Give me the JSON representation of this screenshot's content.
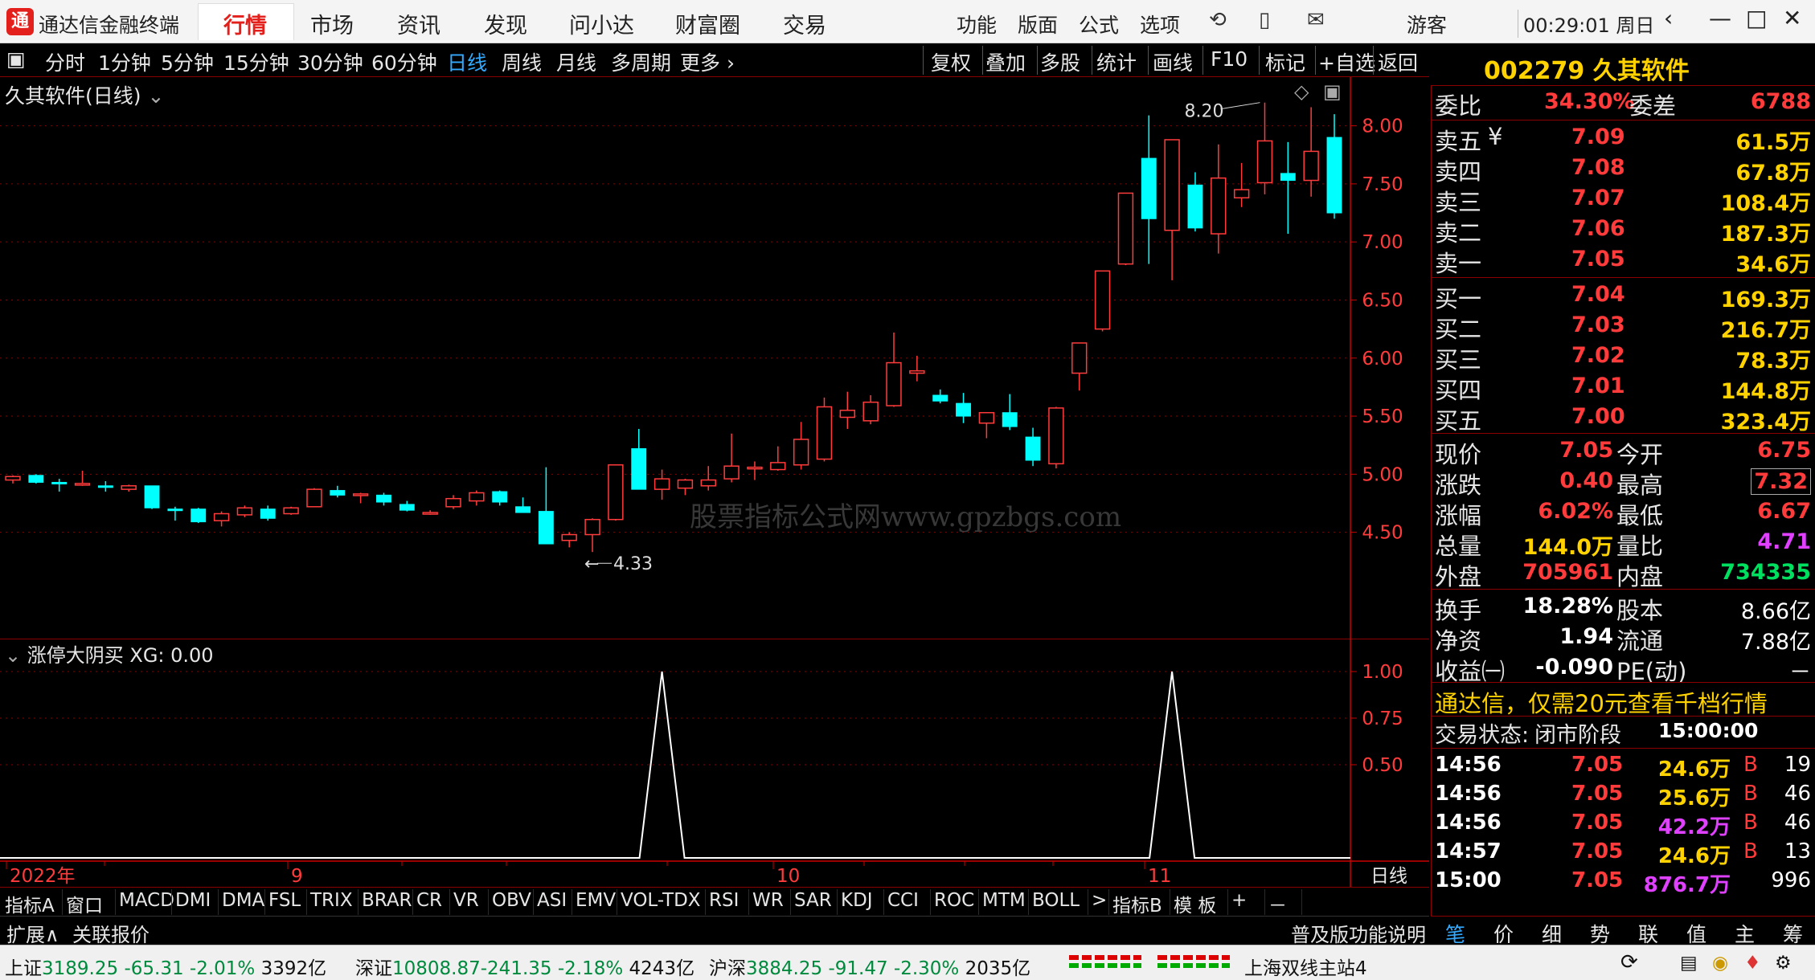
{
  "app": {
    "title": "通达信金融终端",
    "logo": "通"
  },
  "menu": [
    {
      "label": "行情",
      "active": true
    },
    {
      "label": "市场"
    },
    {
      "label": "资讯"
    },
    {
      "label": "发现"
    },
    {
      "label": "问小达"
    },
    {
      "label": "财富圈"
    },
    {
      "label": "交易"
    }
  ],
  "rmenu": [
    "功能",
    "版面",
    "公式",
    "选项"
  ],
  "user": "游客",
  "clock": "00:29:01 周日",
  "periods": [
    "分时",
    "1分钟",
    "5分钟",
    "15分钟",
    "30分钟",
    "60分钟",
    "日线",
    "周线",
    "月线",
    "多周期",
    "更多"
  ],
  "period_selected": "日线",
  "toolbar": [
    "复权",
    "叠加",
    "多股",
    "统计",
    "画线",
    "F10",
    "标记",
    "+自选",
    "返回"
  ],
  "chart": {
    "title": "久其软件(日线)",
    "max_label": "8.20",
    "min_label": "4.33",
    "watermark": "股票指标公式网www.gpzbgs.com",
    "y_ticks": [
      "8.00",
      "7.50",
      "7.00",
      "6.50",
      "6.00",
      "5.50",
      "5.00",
      "4.50"
    ],
    "sub_title": "涨停大阴买 XG: 0.00",
    "sub_ticks": [
      "1.00",
      "0.75",
      "0.50"
    ],
    "x_labels": [
      "2022年",
      "9",
      "10",
      "11"
    ],
    "period_label": "日线"
  },
  "chart_data": {
    "type": "candlestick",
    "title": "久其软件(日线)",
    "ylim": [
      4.2,
      8.35
    ],
    "candles": [
      {
        "o": 4.95,
        "h": 4.99,
        "l": 4.92,
        "c": 4.98
      },
      {
        "o": 4.99,
        "h": 5.0,
        "l": 4.92,
        "c": 4.93
      },
      {
        "o": 4.93,
        "h": 4.96,
        "l": 4.85,
        "c": 4.92
      },
      {
        "o": 4.92,
        "h": 5.03,
        "l": 4.9,
        "c": 4.92
      },
      {
        "o": 4.9,
        "h": 4.94,
        "l": 4.85,
        "c": 4.89
      },
      {
        "o": 4.87,
        "h": 4.91,
        "l": 4.85,
        "c": 4.9
      },
      {
        "o": 4.9,
        "h": 4.9,
        "l": 4.7,
        "c": 4.71
      },
      {
        "o": 4.7,
        "h": 4.72,
        "l": 4.6,
        "c": 4.69
      },
      {
        "o": 4.7,
        "h": 4.71,
        "l": 4.58,
        "c": 4.59
      },
      {
        "o": 4.6,
        "h": 4.68,
        "l": 4.55,
        "c": 4.66
      },
      {
        "o": 4.65,
        "h": 4.73,
        "l": 4.63,
        "c": 4.71
      },
      {
        "o": 4.7,
        "h": 4.73,
        "l": 4.6,
        "c": 4.62
      },
      {
        "o": 4.66,
        "h": 4.72,
        "l": 4.65,
        "c": 4.71
      },
      {
        "o": 4.72,
        "h": 4.88,
        "l": 4.72,
        "c": 4.87
      },
      {
        "o": 4.86,
        "h": 4.9,
        "l": 4.8,
        "c": 4.82
      },
      {
        "o": 4.83,
        "h": 4.84,
        "l": 4.75,
        "c": 4.83
      },
      {
        "o": 4.82,
        "h": 4.84,
        "l": 4.73,
        "c": 4.76
      },
      {
        "o": 4.74,
        "h": 4.77,
        "l": 4.68,
        "c": 4.69
      },
      {
        "o": 4.67,
        "h": 4.69,
        "l": 4.65,
        "c": 4.67
      },
      {
        "o": 4.72,
        "h": 4.82,
        "l": 4.7,
        "c": 4.79
      },
      {
        "o": 4.77,
        "h": 4.86,
        "l": 4.73,
        "c": 4.84
      },
      {
        "o": 4.85,
        "h": 4.86,
        "l": 4.73,
        "c": 4.76
      },
      {
        "o": 4.72,
        "h": 4.8,
        "l": 4.7,
        "c": 4.67
      },
      {
        "o": 4.68,
        "h": 5.06,
        "l": 4.44,
        "c": 4.4
      },
      {
        "o": 4.43,
        "h": 4.5,
        "l": 4.37,
        "c": 4.48
      },
      {
        "o": 4.48,
        "h": 4.62,
        "l": 4.33,
        "c": 4.61
      },
      {
        "o": 4.61,
        "h": 5.08,
        "l": 4.6,
        "c": 5.08
      },
      {
        "o": 5.22,
        "h": 5.39,
        "l": 4.95,
        "c": 4.87
      },
      {
        "o": 4.87,
        "h": 5.04,
        "l": 4.78,
        "c": 4.96
      },
      {
        "o": 4.88,
        "h": 4.96,
        "l": 4.82,
        "c": 4.95
      },
      {
        "o": 4.9,
        "h": 5.07,
        "l": 4.86,
        "c": 4.95
      },
      {
        "o": 4.96,
        "h": 5.35,
        "l": 4.93,
        "c": 5.07
      },
      {
        "o": 5.06,
        "h": 5.11,
        "l": 4.95,
        "c": 5.06
      },
      {
        "o": 5.04,
        "h": 5.24,
        "l": 5.03,
        "c": 5.1
      },
      {
        "o": 5.08,
        "h": 5.45,
        "l": 5.04,
        "c": 5.3
      },
      {
        "o": 5.13,
        "h": 5.66,
        "l": 5.11,
        "c": 5.58
      },
      {
        "o": 5.49,
        "h": 5.71,
        "l": 5.39,
        "c": 5.55
      },
      {
        "o": 5.46,
        "h": 5.68,
        "l": 5.43,
        "c": 5.62
      },
      {
        "o": 5.59,
        "h": 6.22,
        "l": 5.58,
        "c": 5.96
      },
      {
        "o": 5.87,
        "h": 6.02,
        "l": 5.8,
        "c": 5.89
      },
      {
        "o": 5.68,
        "h": 5.73,
        "l": 5.61,
        "c": 5.63
      },
      {
        "o": 5.61,
        "h": 5.7,
        "l": 5.44,
        "c": 5.5
      },
      {
        "o": 5.44,
        "h": 5.52,
        "l": 5.31,
        "c": 5.53
      },
      {
        "o": 5.53,
        "h": 5.69,
        "l": 5.38,
        "c": 5.41
      },
      {
        "o": 5.32,
        "h": 5.4,
        "l": 5.07,
        "c": 5.12
      },
      {
        "o": 5.09,
        "h": 5.58,
        "l": 5.05,
        "c": 5.57
      },
      {
        "o": 5.87,
        "h": 6.13,
        "l": 5.72,
        "c": 6.13
      },
      {
        "o": 6.25,
        "h": 6.75,
        "l": 6.23,
        "c": 6.75
      },
      {
        "o": 6.81,
        "h": 7.42,
        "l": 6.8,
        "c": 7.42
      },
      {
        "o": 7.72,
        "h": 8.09,
        "l": 6.81,
        "c": 7.2
      },
      {
        "o": 7.1,
        "h": 7.88,
        "l": 6.67,
        "c": 7.88
      },
      {
        "o": 7.49,
        "h": 7.6,
        "l": 7.09,
        "c": 7.12
      },
      {
        "o": 7.07,
        "h": 7.84,
        "l": 6.9,
        "c": 7.55
      },
      {
        "o": 7.38,
        "h": 7.68,
        "l": 7.3,
        "c": 7.45
      },
      {
        "o": 7.51,
        "h": 8.2,
        "l": 7.41,
        "c": 7.87
      },
      {
        "o": 7.59,
        "h": 7.86,
        "l": 7.07,
        "c": 7.53
      },
      {
        "o": 7.53,
        "h": 8.16,
        "l": 7.39,
        "c": 7.78
      },
      {
        "o": 7.9,
        "h": 8.1,
        "l": 7.2,
        "c": 7.25
      }
    ],
    "indicator": {
      "name": "涨停大阴买 XG",
      "signal_index": [
        28,
        50
      ],
      "ylim": [
        0,
        1
      ]
    },
    "xlabels": [
      "2022年",
      "9",
      "10",
      "11"
    ]
  },
  "quote": {
    "code": "002279",
    "name": "久其软件",
    "weibi_label": "委比",
    "weibi": "34.30%",
    "weicha_label": "委差",
    "weicha": "6788",
    "sell": [
      {
        "label": "卖五",
        "mark": "¥",
        "price": "7.09",
        "vol": "61.5万"
      },
      {
        "label": "卖四",
        "price": "7.08",
        "vol": "67.8万"
      },
      {
        "label": "卖三",
        "price": "7.07",
        "vol": "108.4万"
      },
      {
        "label": "卖二",
        "price": "7.06",
        "vol": "187.3万"
      },
      {
        "label": "卖一",
        "price": "7.05",
        "vol": "34.6万"
      }
    ],
    "buy": [
      {
        "label": "买一",
        "price": "7.04",
        "vol": "169.3万"
      },
      {
        "label": "买二",
        "price": "7.03",
        "vol": "216.7万"
      },
      {
        "label": "买三",
        "price": "7.02",
        "vol": "78.3万"
      },
      {
        "label": "买四",
        "price": "7.01",
        "vol": "144.8万"
      },
      {
        "label": "买五",
        "price": "7.00",
        "vol": "323.4万"
      }
    ],
    "stats": [
      {
        "k1": "现价",
        "v1": "7.05",
        "c1": "red",
        "k2": "今开",
        "v2": "6.75",
        "c2": "red"
      },
      {
        "k1": "涨跌",
        "v1": "0.40",
        "c1": "red",
        "k2": "最高",
        "v2": "7.32",
        "c2": "red"
      },
      {
        "k1": "涨幅",
        "v1": "6.02%",
        "c1": "red",
        "k2": "最低",
        "v2": "6.67",
        "c2": "red"
      },
      {
        "k1": "总量",
        "v1": "144.0万",
        "c1": "yellow",
        "k2": "量比",
        "v2": "4.71",
        "c2": "magenta"
      },
      {
        "k1": "外盘",
        "v1": "705961",
        "c1": "red",
        "k2": "内盘",
        "v2": "734335",
        "c2": "green"
      }
    ],
    "stats2": [
      {
        "k1": "换手",
        "v1": "18.28%",
        "k2": "股本",
        "v2": "8.66亿"
      },
      {
        "k1": "净资",
        "v1": "1.94",
        "k2": "流通",
        "v2": "7.88亿"
      },
      {
        "k1": "收益㈠",
        "v1": "-0.090",
        "k2": "PE(动)",
        "v2": "－"
      }
    ],
    "promo": "通达信，仅需20元查看千档行情",
    "status_label": "交易状态:",
    "status": "闭市阶段",
    "status_time": "15:00:00",
    "ticks": [
      {
        "t": "14:56",
        "p": "7.05",
        "v": "24.6万",
        "v_color": "yellow",
        "s": "B",
        "n": "19"
      },
      {
        "t": "14:56",
        "p": "7.05",
        "v": "25.6万",
        "v_color": "yellow",
        "s": "B",
        "n": "46"
      },
      {
        "t": "14:56",
        "p": "7.05",
        "v": "42.2万",
        "v_color": "magenta",
        "s": "B",
        "n": "46"
      },
      {
        "t": "14:57",
        "p": "7.05",
        "v": "24.6万",
        "v_color": "yellow",
        "s": "B",
        "n": "13"
      },
      {
        "t": "15:00",
        "p": "7.05",
        "v": "876.7万",
        "v_color": "magenta",
        "s": "",
        "n": "996"
      }
    ]
  },
  "indicator_tabs": [
    "指标A",
    "窗口",
    "MACD",
    "DMI",
    "DMA",
    "FSL",
    "TRIX",
    "BRAR",
    "CR",
    "VR",
    "OBV",
    "ASI",
    "EMV",
    "VOL-TDX",
    "RSI",
    "WR",
    "SAR",
    "KDJ",
    "CCI",
    "ROC",
    "MTM",
    "BOLL",
    ">",
    "指标B",
    "模 板",
    "+",
    "－"
  ],
  "ext": {
    "expand": "扩展∧",
    "related": "关联报价",
    "help": "普及版功能说明"
  },
  "right_tabs": [
    "笔",
    "价",
    "细",
    "势",
    "联",
    "值",
    "主",
    "筹"
  ],
  "status": {
    "sh_label": "上证",
    "sh": "3189.25",
    "sh_chg": "-65.31",
    "sh_pct": "-2.01%",
    "sh_amt": "3392亿",
    "sz_label": "深证",
    "sz": "10808.87",
    "sz_chg": "-241.35",
    "sz_pct": "-2.18%",
    "sz_amt": "4243亿",
    "hs_label": "沪深",
    "hs": "3884.25",
    "hs_chg": "-91.47",
    "hs_pct": "-2.30%",
    "hs_amt": "2035亿",
    "server": "上海双线主站4"
  },
  "colors": {
    "up": "#ff3b3b",
    "down": "#00ffff",
    "grid": "#8b0000",
    "accent": "#e3201b"
  }
}
